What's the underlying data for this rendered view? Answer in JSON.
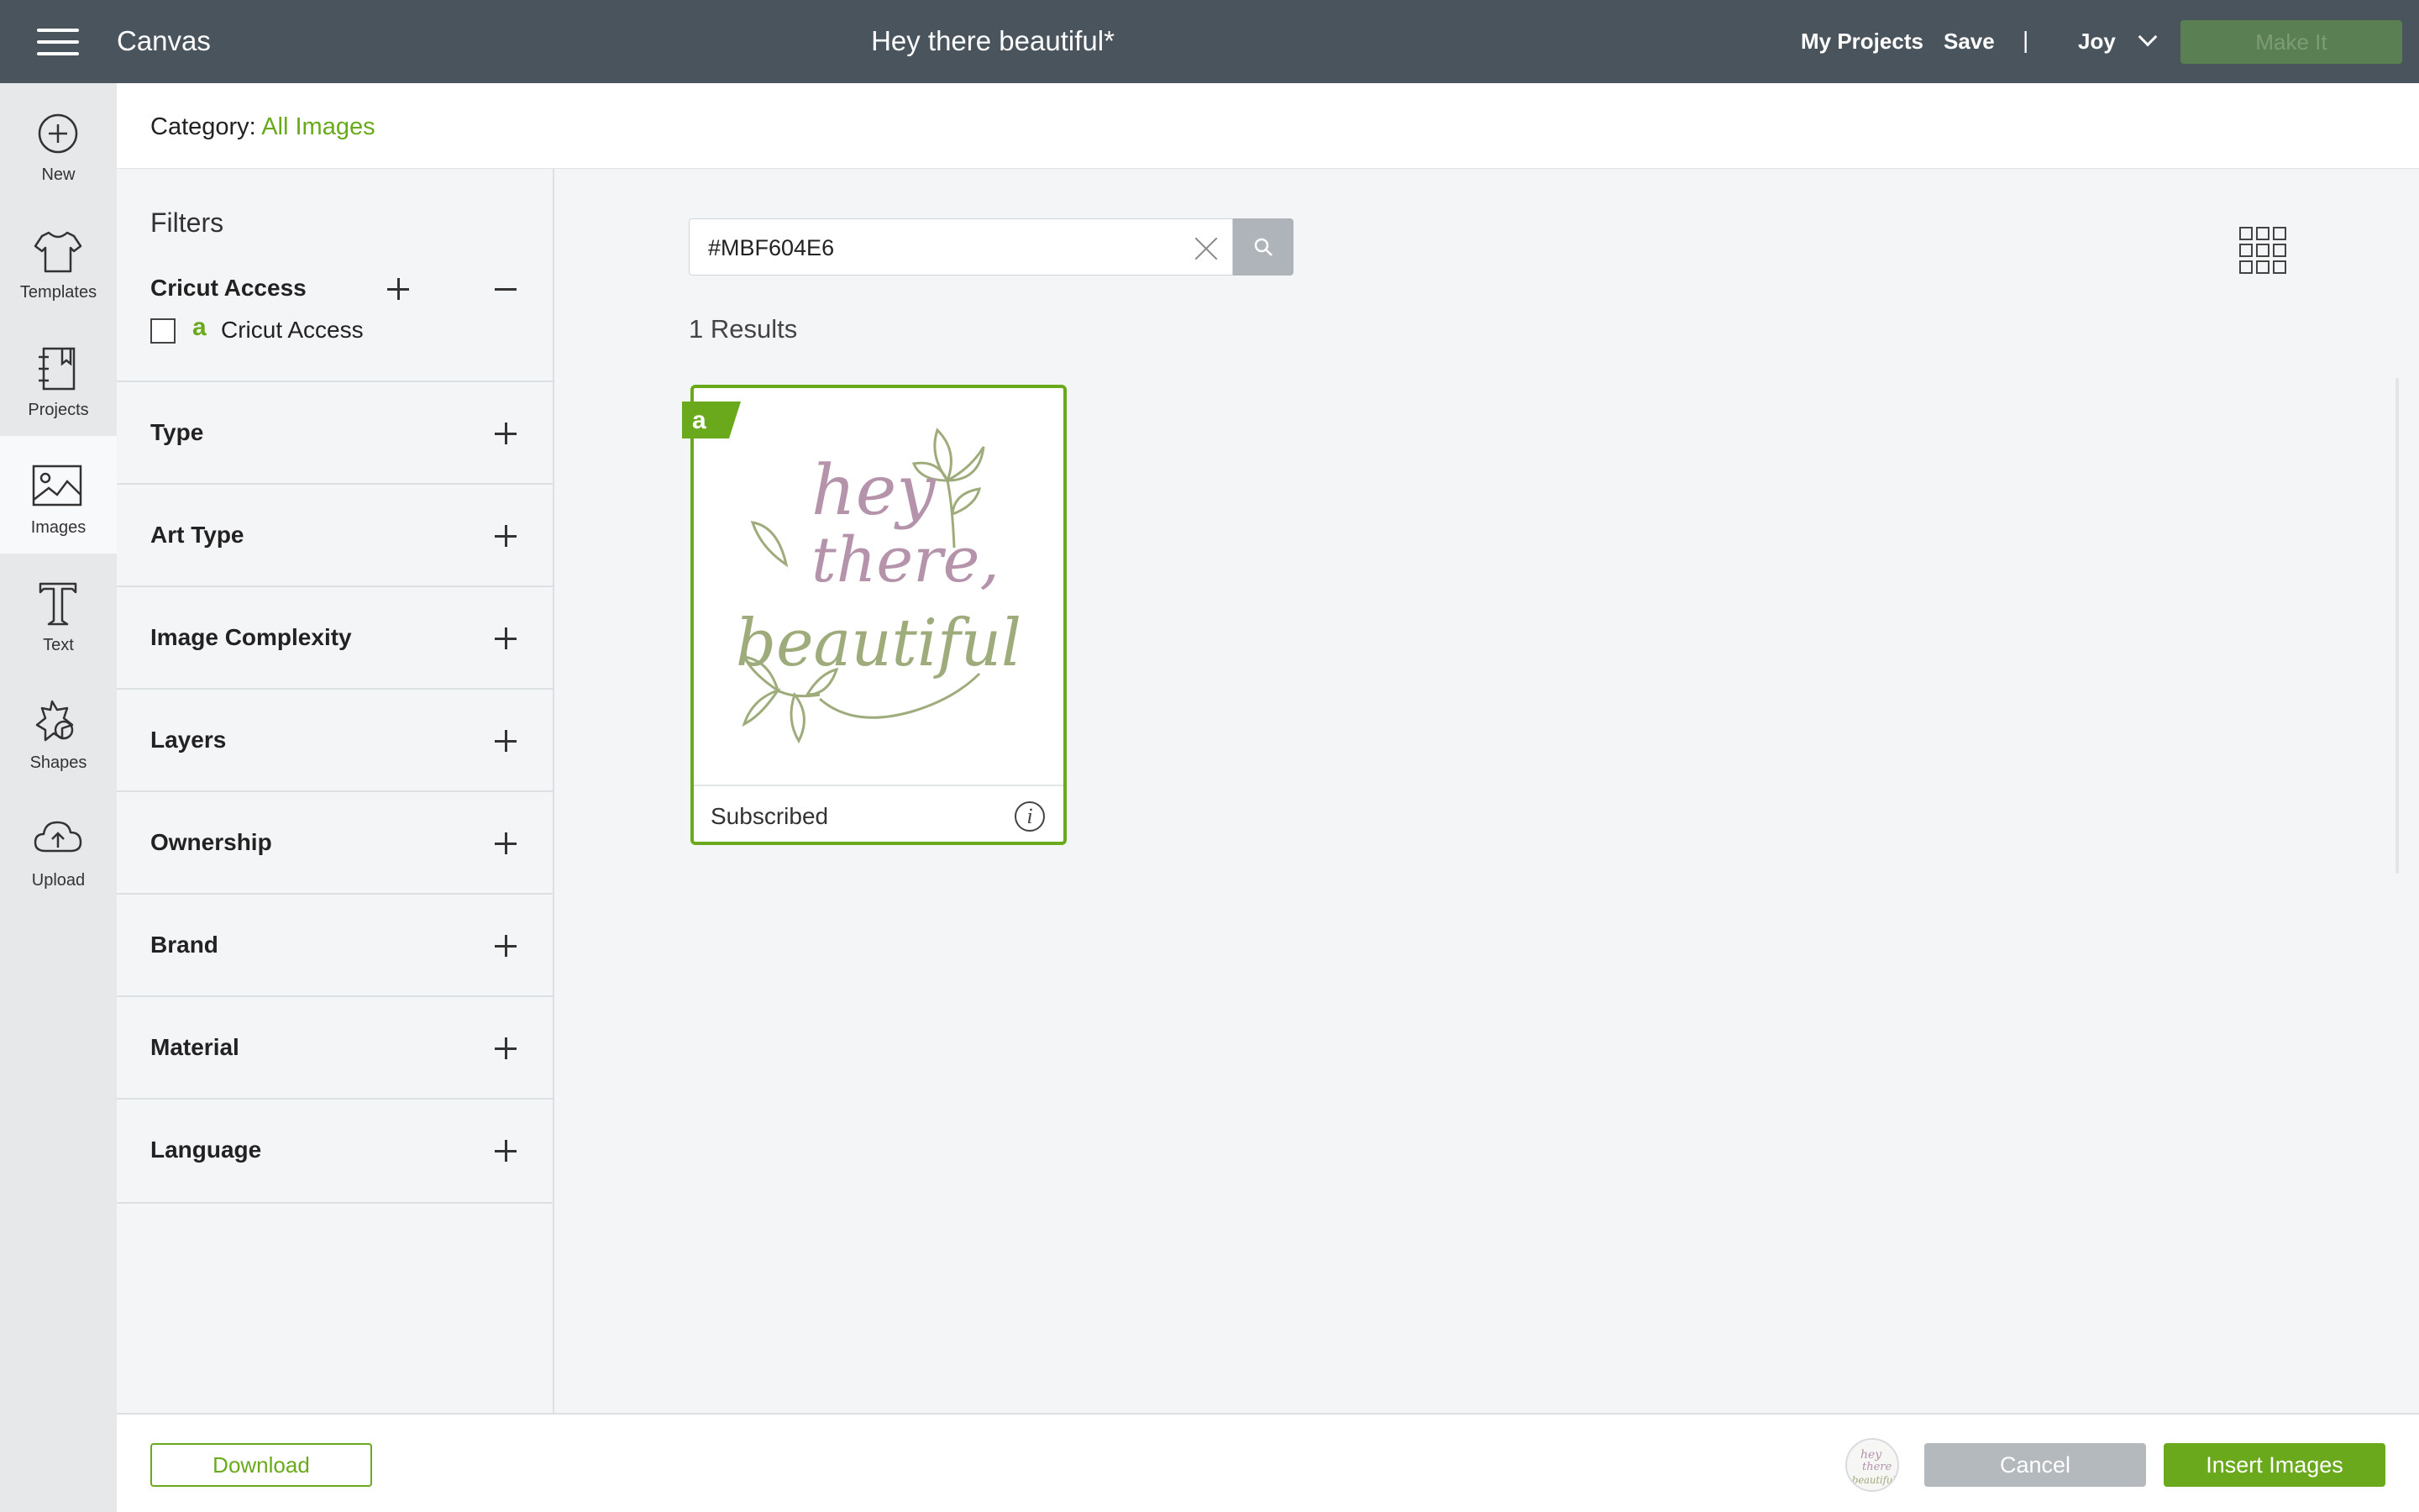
{
  "topbar": {
    "app_name": "Canvas",
    "project_title": "Hey there beautiful*",
    "my_projects": "My Projects",
    "save": "Save",
    "separator": "|",
    "user": "Joy",
    "make_it": "Make It"
  },
  "leftnav": {
    "items": [
      {
        "label": "New",
        "icon": "plus-circle-icon"
      },
      {
        "label": "Templates",
        "icon": "tshirt-icon"
      },
      {
        "label": "Projects",
        "icon": "notebook-icon"
      },
      {
        "label": "Images",
        "icon": "image-icon"
      },
      {
        "label": "Text",
        "icon": "text-t-icon"
      },
      {
        "label": "Shapes",
        "icon": "shapes-icon"
      },
      {
        "label": "Upload",
        "icon": "cloud-upload-icon"
      }
    ],
    "active": "Images"
  },
  "category": {
    "label": "Category:",
    "value": "All Images"
  },
  "filters": {
    "title": "Filters",
    "cricut_access": {
      "title": "Cricut Access",
      "option_label": "Cricut Access",
      "badge": "a"
    },
    "sections": [
      "Type",
      "Art Type",
      "Image Complexity",
      "Layers",
      "Ownership",
      "Brand",
      "Material",
      "Language"
    ]
  },
  "search": {
    "value": "#MBF604E6"
  },
  "results": {
    "count_text": "1 Results",
    "items": [
      {
        "status": "Subscribed",
        "badge": "a",
        "art_words": [
          "hey",
          "there,",
          "beautiful"
        ]
      }
    ]
  },
  "bottombar": {
    "download": "Download",
    "cancel": "Cancel",
    "insert": "Insert Images",
    "thumb_words": [
      "hey",
      "there",
      "beautiful"
    ]
  },
  "colors": {
    "accent_green": "#6aa91c",
    "topbar": "#4a545c",
    "art_mauve": "#b493ab",
    "art_sage": "#9eac7c"
  }
}
